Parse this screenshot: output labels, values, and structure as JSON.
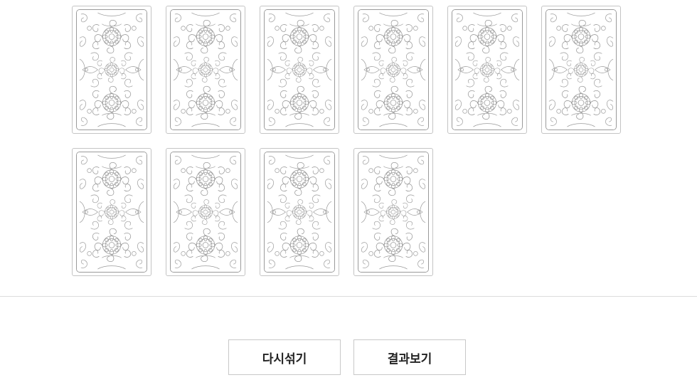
{
  "cards": [
    {
      "id": 1,
      "state": "face-down"
    },
    {
      "id": 2,
      "state": "face-down"
    },
    {
      "id": 3,
      "state": "face-down"
    },
    {
      "id": 4,
      "state": "face-down"
    },
    {
      "id": 5,
      "state": "face-down"
    },
    {
      "id": 6,
      "state": "face-down"
    },
    {
      "id": 7,
      "state": "face-down"
    },
    {
      "id": 8,
      "state": "face-down"
    },
    {
      "id": 9,
      "state": "face-down"
    },
    {
      "id": 10,
      "state": "face-down"
    }
  ],
  "actions": {
    "reshuffle_label": "다시섞기",
    "result_label": "결과보기"
  },
  "colors": {
    "card_border": "#c4c4c4",
    "card_pattern": "#9a9a9a",
    "button_border": "#c8c8c8",
    "button_text": "#222222"
  }
}
